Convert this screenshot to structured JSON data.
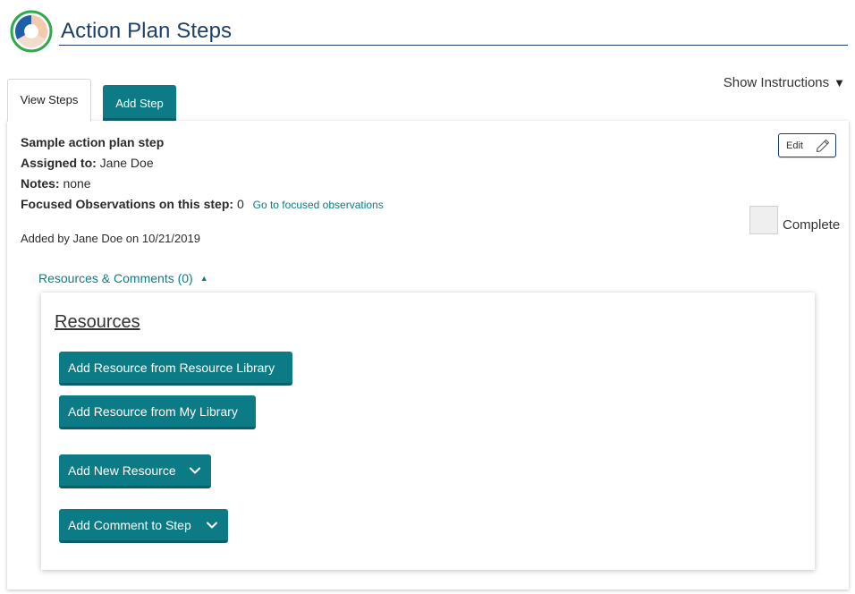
{
  "header": {
    "title": "Action Plan Steps",
    "logo_icon": "circular-segments-logo"
  },
  "show_instructions": {
    "label": "Show Instructions",
    "icon": "caret-down-icon",
    "caret": "▼"
  },
  "tabs": [
    {
      "label": "View Steps",
      "active": true
    },
    {
      "label": "Add Step",
      "active": false
    }
  ],
  "step": {
    "title": "Sample action plan step",
    "assigned_label": "Assigned to:",
    "assigned_value": "Jane Doe",
    "notes_label": "Notes:",
    "notes_value": "none",
    "focused_label": "Focused Observations on this step:",
    "focused_count": "0",
    "focused_link": "Go to focused observations",
    "added_by": "Added by Jane Doe on 10/21/2019",
    "edit_label": "Edit",
    "complete_label": "Complete",
    "complete_checked": false
  },
  "resources_toggle": {
    "label": "Resources & Comments (0)",
    "arrow": "▲"
  },
  "resources_panel": {
    "heading": "Resources",
    "buttons": {
      "from_library": "Add Resource from Resource Library",
      "from_my_library": "Add Resource from My Library",
      "new_resource": "Add New Resource",
      "add_comment": "Add Comment to Step"
    }
  },
  "colors": {
    "accent": "#0c7b85",
    "title": "#1f3f66"
  }
}
